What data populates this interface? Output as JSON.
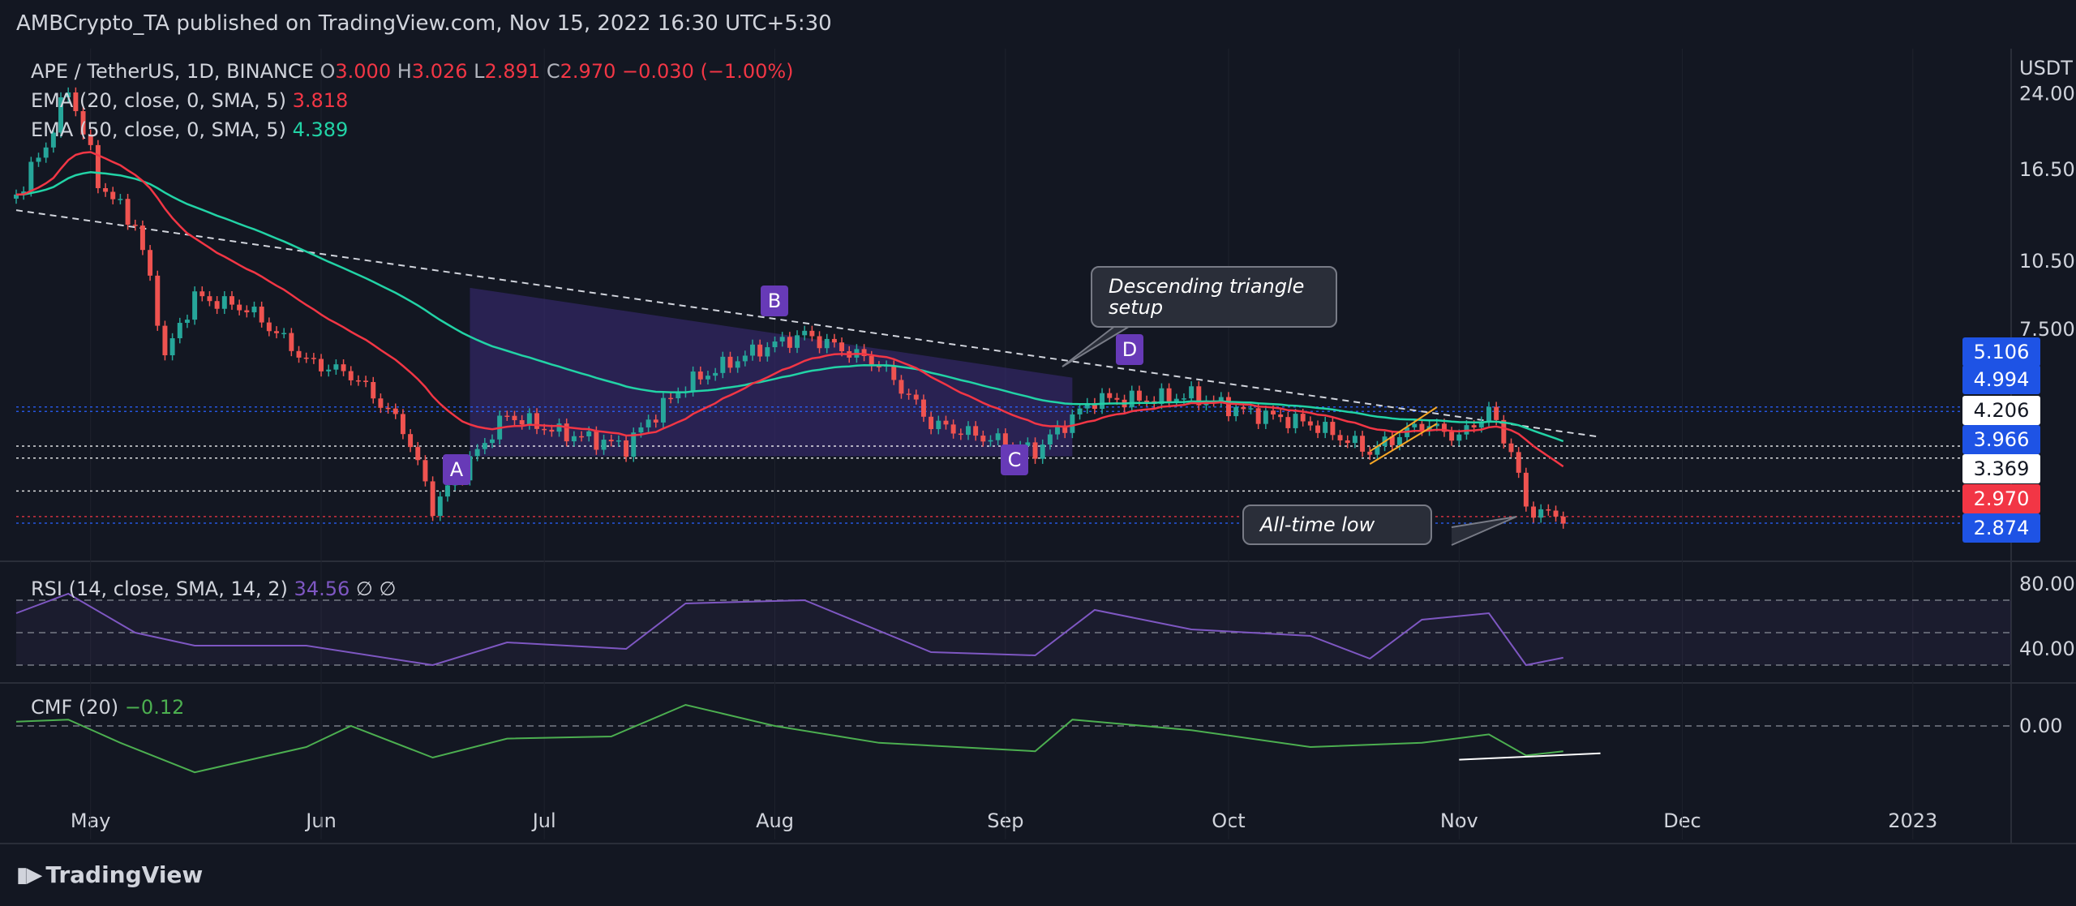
{
  "header": {
    "published": "AMBCrypto_TA published on TradingView.com, Nov 15, 2022 16:30 UTC+5:30"
  },
  "footer": {
    "brand": "TradingView"
  },
  "legend": {
    "symbol": "APE / TetherUS, 1D, BINANCE",
    "o_label": "O",
    "o_value": "3.000",
    "h_label": "H",
    "h_value": "3.026",
    "l_label": "L",
    "l_value": "2.891",
    "c_label": "C",
    "c_value": "2.970",
    "change": "−0.030 (−1.00%)",
    "ema20_label": "EMA (20, close, 0, SMA, 5)",
    "ema20_value": "3.818",
    "ema50_label": "EMA (50, close, 0, SMA, 5)",
    "ema50_value": "4.389",
    "rsi_label": "RSI (14, close, SMA, 14, 2)",
    "rsi_value": "34.56",
    "rsi_extra": "∅ ∅",
    "cmf_label": "CMF (20)",
    "cmf_value": "−0.12"
  },
  "annotations": {
    "callout_triangle": "Descending triangle setup",
    "callout_low": "All-time low",
    "badges": [
      "A",
      "B",
      "C",
      "D"
    ]
  },
  "price_tags": [
    {
      "value": "5.106",
      "bg": "#1e53e5",
      "fg": "#ffffff"
    },
    {
      "value": "4.994",
      "bg": "#1e53e5",
      "fg": "#ffffff"
    },
    {
      "value": "4.206",
      "bg": "#ffffff",
      "fg": "#131722"
    },
    {
      "value": "3.966",
      "bg": "#1e53e5",
      "fg": "#ffffff"
    },
    {
      "value": "3.369",
      "bg": "#ffffff",
      "fg": "#131722"
    },
    {
      "value": "2.970",
      "bg": "#f23645",
      "fg": "#ffffff"
    },
    {
      "value": "2.874",
      "bg": "#1e53e5",
      "fg": "#ffffff"
    }
  ],
  "colors": {
    "bg": "#131722",
    "up": "#26a69a",
    "down": "#ef5350",
    "ema20": "#f23645",
    "ema50": "#22d3a6",
    "rsi": "#7e57c2",
    "cmf": "#4caf50",
    "grid": "#2a2e39",
    "channel": "#2962ff",
    "triangle_fill": "#3c2c7a"
  },
  "chart_data": [
    {
      "type": "candlestick",
      "title": "APE / TetherUS, 1D, BINANCE",
      "y_unit": "USDT",
      "y_scale": "log",
      "y_ticks": [
        "24.000",
        "16.500",
        "10.500",
        "7.500"
      ],
      "x_ticks": [
        "May",
        "Jun",
        "Jul",
        "Aug",
        "Sep",
        "Oct",
        "Nov",
        "Dec",
        "2023"
      ],
      "x_range": [
        "2022-04-21",
        "2023-01-14"
      ],
      "ylim": [
        2.4,
        30
      ],
      "ohlc_last": {
        "open": 3.0,
        "high": 3.026,
        "low": 2.891,
        "close": 2.97
      },
      "close_points": [
        [
          "2022-04-21",
          14.5
        ],
        [
          "2022-04-25",
          18.5
        ],
        [
          "2022-04-28",
          24.5
        ],
        [
          "2022-05-02",
          15.5
        ],
        [
          "2022-05-07",
          12.5
        ],
        [
          "2022-05-11",
          6.5
        ],
        [
          "2022-05-15",
          8.8
        ],
        [
          "2022-05-22",
          8.3
        ],
        [
          "2022-05-30",
          6.4
        ],
        [
          "2022-06-05",
          6.0
        ],
        [
          "2022-06-12",
          4.6
        ],
        [
          "2022-06-16",
          3.1
        ],
        [
          "2022-06-20",
          3.7
        ],
        [
          "2022-06-26",
          4.9
        ],
        [
          "2022-07-03",
          4.5
        ],
        [
          "2022-07-12",
          4.2
        ],
        [
          "2022-07-20",
          5.7
        ],
        [
          "2022-07-30",
          6.8
        ],
        [
          "2022-08-05",
          7.3
        ],
        [
          "2022-08-15",
          6.3
        ],
        [
          "2022-08-22",
          4.7
        ],
        [
          "2022-08-29",
          4.4
        ],
        [
          "2022-09-05",
          4.1
        ],
        [
          "2022-09-13",
          5.3
        ],
        [
          "2022-09-20",
          5.3
        ],
        [
          "2022-09-26",
          5.4
        ],
        [
          "2022-10-03",
          5.0
        ],
        [
          "2022-10-12",
          4.7
        ],
        [
          "2022-10-20",
          4.1
        ],
        [
          "2022-10-27",
          4.7
        ],
        [
          "2022-11-01",
          4.4
        ],
        [
          "2022-11-05",
          5.0
        ],
        [
          "2022-11-08",
          4.1
        ],
        [
          "2022-11-10",
          3.1
        ],
        [
          "2022-11-13",
          3.0
        ],
        [
          "2022-11-15",
          2.97
        ]
      ],
      "ema20_last": 3.818,
      "ema50_last": 4.389,
      "levels": [
        5.106,
        4.994,
        4.206,
        3.966,
        3.369,
        2.97,
        2.874
      ]
    },
    {
      "type": "line",
      "title": "RSI (14, close, SMA, 14, 2)",
      "y_ticks": [
        "80.00",
        "40.00"
      ],
      "last_value": 34.56,
      "points": [
        [
          "2022-04-21",
          62
        ],
        [
          "2022-04-28",
          74
        ],
        [
          "2022-05-07",
          50
        ],
        [
          "2022-05-15",
          42
        ],
        [
          "2022-05-30",
          42
        ],
        [
          "2022-06-16",
          30
        ],
        [
          "2022-06-26",
          44
        ],
        [
          "2022-07-12",
          40
        ],
        [
          "2022-07-20",
          68
        ],
        [
          "2022-08-05",
          70
        ],
        [
          "2022-08-22",
          38
        ],
        [
          "2022-09-05",
          36
        ],
        [
          "2022-09-13",
          64
        ],
        [
          "2022-09-26",
          52
        ],
        [
          "2022-10-12",
          48
        ],
        [
          "2022-10-20",
          34
        ],
        [
          "2022-10-27",
          58
        ],
        [
          "2022-11-05",
          62
        ],
        [
          "2022-11-10",
          30
        ],
        [
          "2022-11-15",
          34.56
        ]
      ]
    },
    {
      "type": "line",
      "title": "CMF (20)",
      "y_ticks": [
        "0.00"
      ],
      "last_value": -0.12,
      "points": [
        [
          "2022-04-21",
          0.02
        ],
        [
          "2022-04-28",
          0.03
        ],
        [
          "2022-05-05",
          -0.08
        ],
        [
          "2022-05-15",
          -0.22
        ],
        [
          "2022-05-30",
          -0.1
        ],
        [
          "2022-06-05",
          0.0
        ],
        [
          "2022-06-16",
          -0.15
        ],
        [
          "2022-06-26",
          -0.06
        ],
        [
          "2022-07-10",
          -0.05
        ],
        [
          "2022-07-20",
          0.1
        ],
        [
          "2022-08-01",
          0.0
        ],
        [
          "2022-08-15",
          -0.08
        ],
        [
          "2022-09-05",
          -0.12
        ],
        [
          "2022-09-10",
          0.03
        ],
        [
          "2022-09-26",
          -0.02
        ],
        [
          "2022-10-12",
          -0.1
        ],
        [
          "2022-10-27",
          -0.08
        ],
        [
          "2022-11-05",
          -0.04
        ],
        [
          "2022-11-10",
          -0.14
        ],
        [
          "2022-11-15",
          -0.12
        ]
      ]
    }
  ]
}
